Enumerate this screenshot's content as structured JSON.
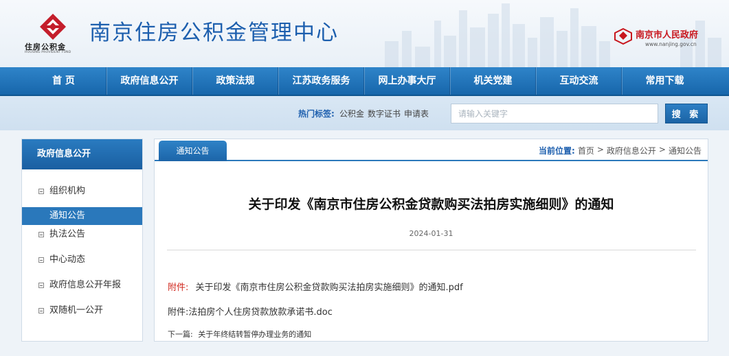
{
  "header": {
    "title": "南京住房公积金管理中心",
    "logo_cn": "住房公积金",
    "logo_en": "HOUSING PROVIDENT FUND",
    "gov_name": "南京市人民政府",
    "gov_url": "www.nanjing.gov.cn",
    "logo_icon": "provident-fund-logo-icon",
    "emblem_icon": "nanjing-government-emblem-icon"
  },
  "nav": {
    "items": [
      {
        "label": "首 页"
      },
      {
        "label": "政府信息公开"
      },
      {
        "label": "政策法规"
      },
      {
        "label": "江苏政务服务"
      },
      {
        "label": "网上办事大厅"
      },
      {
        "label": "机关党建"
      },
      {
        "label": "互动交流"
      },
      {
        "label": "常用下载"
      }
    ]
  },
  "search": {
    "hot_label": "热门标签:",
    "hot_tags": [
      "公积金",
      "数字证书",
      "申请表"
    ],
    "placeholder": "请输入关键字",
    "button_label": "搜 索"
  },
  "sidebar": {
    "title": "政府信息公开",
    "items": [
      {
        "label": "组织机构",
        "active": false
      },
      {
        "label": "通知公告",
        "active": true
      },
      {
        "label": "执法公告",
        "active": false
      },
      {
        "label": "中心动态",
        "active": false
      },
      {
        "label": "政府信息公开年报",
        "active": false
      },
      {
        "label": "双随机一公开",
        "active": false
      }
    ]
  },
  "main": {
    "tab_label": "通知公告",
    "breadcrumb": {
      "label": "当前位置:",
      "items": [
        "首页",
        "政府信息公开",
        "通知公告"
      ],
      "separator": ">"
    },
    "article": {
      "title": "关于印发《南京市住房公积金贷款购买法拍房实施细则》的通知",
      "date": "2024-01-31",
      "attachments": [
        {
          "label": "附件:",
          "file": "关于印发《南京市住房公积金贷款购买法拍房实施细则》的通知.pdf"
        },
        {
          "label": "附件:",
          "file": "法拍房个人住房贷款放款承诺书.doc"
        }
      ],
      "next_label": "下一篇:",
      "next_title": "关于年终结转暂停办理业务的通知"
    }
  },
  "colors": {
    "brand_blue": "#1d5fae",
    "nav_blue": "#1766ab",
    "gov_red": "#c8161d",
    "attachment_red": "#d0271d"
  }
}
